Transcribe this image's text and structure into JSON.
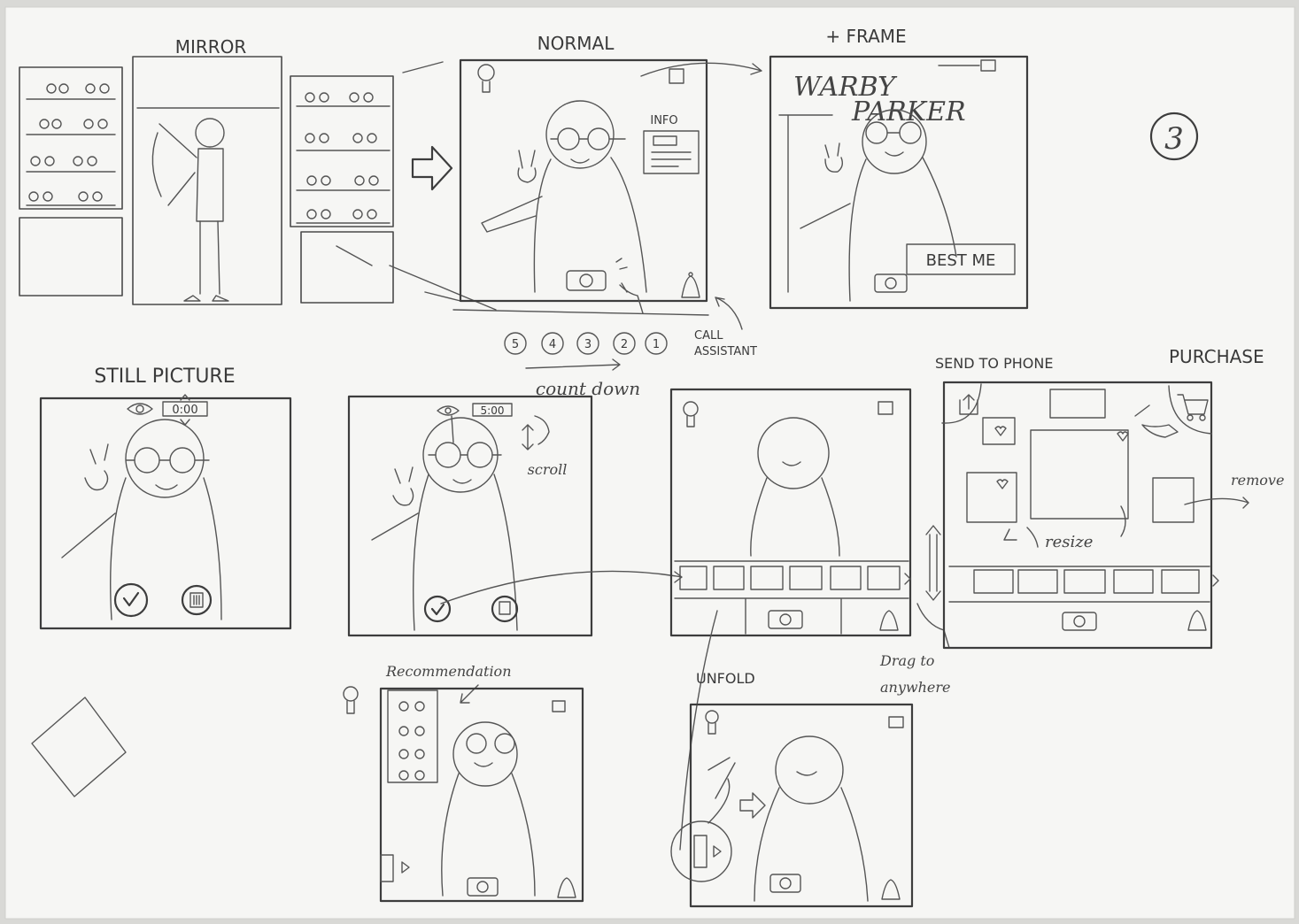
{
  "page_number": "3",
  "labels": {
    "mirror": "MIRROR",
    "normal": "NORMAL",
    "frame": "+ FRAME",
    "still_picture": "STILL PICTURE",
    "send_to_phone": "SEND TO PHONE",
    "purchase": "PURCHASE",
    "recommendation": "Recommendation",
    "unfold": "UNFOLD"
  },
  "normal_screen": {
    "info": "INFO",
    "countdown": [
      "5",
      "4",
      "3",
      "2",
      "1"
    ],
    "count_down": "count down",
    "call": "CALL",
    "assistant": "ASSISTANT"
  },
  "frame_screen": {
    "brand_line1": "WARBY",
    "brand_line2": "PARKER",
    "best_me": "BEST ME"
  },
  "still_screen": {
    "timer": "0:00"
  },
  "scroll_screen": {
    "timer": "5:00",
    "scroll": "scroll"
  },
  "gallery_screen": {
    "drag_line1": "Drag to",
    "drag_line2": "anywhere"
  },
  "phone_screen": {
    "remove": "remove",
    "resize": "resize"
  }
}
